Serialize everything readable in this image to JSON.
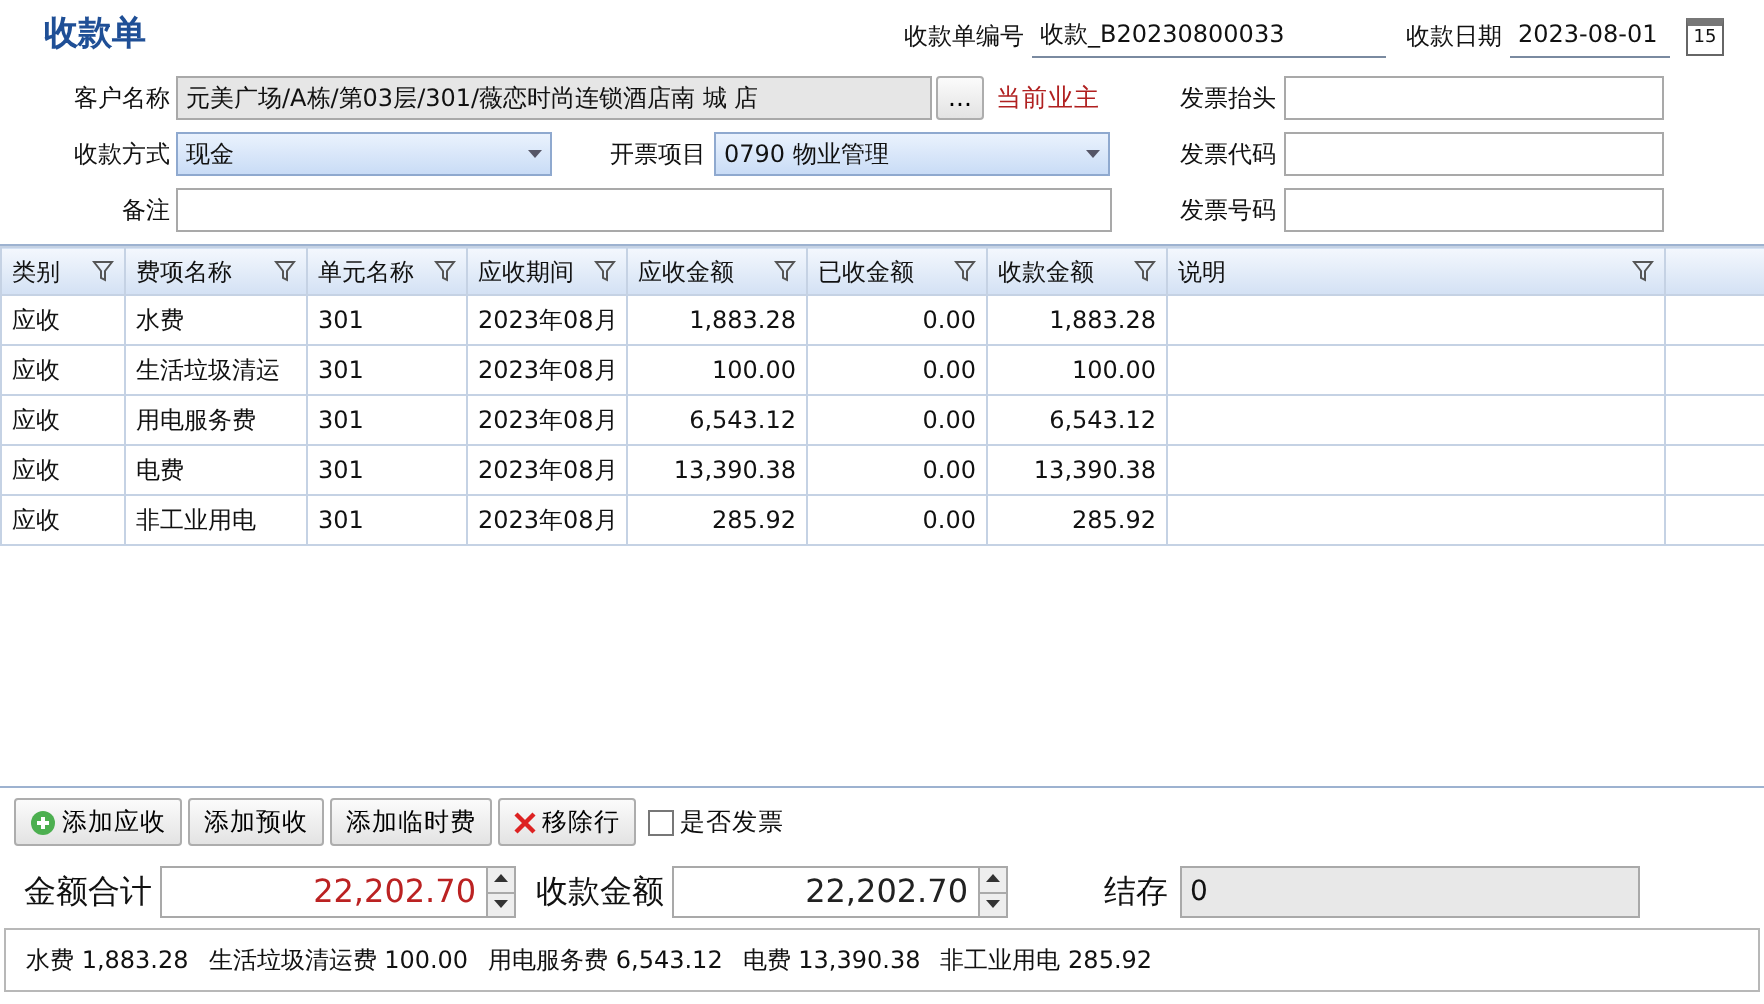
{
  "window": {
    "title": "收款单"
  },
  "header": {
    "receipt_no_label": "收款单编号",
    "receipt_no": "收款_B20230800033",
    "date_label": "收款日期",
    "date": "2023-08-01",
    "calendar_day": "15"
  },
  "form": {
    "customer_label": "客户名称",
    "customer": "元美广场/A栋/第03层/301/薇恋时尚连锁酒店南 城 店",
    "browse_button": "...",
    "owner_note": "当前业主",
    "payment_method_label": "收款方式",
    "payment_method": "现金",
    "invoice_item_label": "开票项目",
    "invoice_item": "0790 物业管理",
    "remark_label": "备注",
    "invoice_fields": [
      {
        "label": "发票抬头"
      },
      {
        "label": "发票代码"
      },
      {
        "label": "发票号码"
      }
    ]
  },
  "table": {
    "columns": [
      "类别",
      "费项名称",
      "单元名称",
      "应收期间",
      "应收金额",
      "已收金额",
      "收款金额",
      "说明"
    ],
    "rows": [
      [
        "应收",
        "水费",
        "301",
        "2023年08月",
        "1,883.28",
        "0.00",
        "1,883.28"
      ],
      [
        "应收",
        "生活垃圾清运",
        "301",
        "2023年08月",
        "100.00",
        "0.00",
        "100.00"
      ],
      [
        "应收",
        "用电服务费",
        "301",
        "2023年08月",
        "6,543.12",
        "0.00",
        "6,543.12"
      ],
      [
        "应收",
        "电费",
        "301",
        "2023年08月",
        "13,390.38",
        "0.00",
        "13,390.38"
      ],
      [
        "应收",
        "非工业用电",
        "301",
        "2023年08月",
        "285.92",
        "0.00",
        "285.92"
      ]
    ]
  },
  "buttons": [
    {
      "label": "添加应收",
      "kind": "add"
    },
    {
      "label": "添加预收",
      "kind": "plain"
    },
    {
      "label": "添加临时费",
      "kind": "plain"
    },
    {
      "label": "移除行",
      "kind": "remove"
    }
  ],
  "invoice_checkbox": {
    "label": "是否发票",
    "checked": false
  },
  "totals": {
    "total_label": "金额合计",
    "total": "22,202.70",
    "received_label": "收款金额",
    "received": "22,202.70",
    "balance_label": "结存",
    "balance": "0"
  },
  "summary": [
    {
      "name": "水费",
      "amount": "1,883.28"
    },
    {
      "name": "生活垃圾清运费",
      "amount": "100.00"
    },
    {
      "name": "用电服务费",
      "amount": "6,543.12"
    },
    {
      "name": "电费",
      "amount": "13,390.38"
    },
    {
      "name": "非工业用电",
      "amount": "285.92"
    }
  ]
}
